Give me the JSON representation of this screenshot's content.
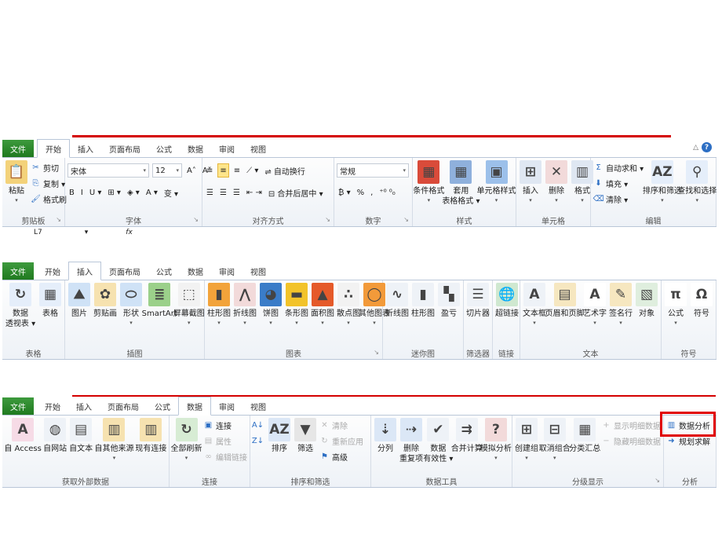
{
  "colors": {
    "file_tab": "#2a8a2a",
    "accent_red": "#d40000",
    "highlight": "#fde58a"
  },
  "ribbons": [
    {
      "tabs": [
        "文件",
        "开始",
        "插入",
        "页面布局",
        "公式",
        "数据",
        "审阅",
        "视图"
      ],
      "active_tab": 1,
      "help_icons": [
        "minimize-ribbon-icon",
        "help-icon"
      ],
      "namebox": "L7",
      "fx": "fx",
      "groups": [
        {
          "label": "剪贴板",
          "launcher": true,
          "cols": [
            {
              "t": "large",
              "label": "粘贴",
              "icon": "paste-icon",
              "dd": true
            },
            {
              "t": "small",
              "items": [
                {
                  "label": "剪切",
                  "icon": "scissors-icon"
                },
                {
                  "label": "复制 ▾",
                  "icon": "copy-icon"
                },
                {
                  "label": "格式刷",
                  "icon": "format-painter-icon"
                }
              ]
            }
          ]
        },
        {
          "label": "字体",
          "launcher": true,
          "cols": [
            {
              "t": "rows",
              "rows": [
                [
                  {
                    "kind": "combo",
                    "name": "font-name-combo",
                    "text": "宋体"
                  },
                  {
                    "kind": "combo",
                    "name": "font-size-combo",
                    "text": "12"
                  },
                  {
                    "kind": "btn",
                    "name": "grow-font-button",
                    "text": "A˄"
                  },
                  {
                    "kind": "btn",
                    "name": "shrink-font-button",
                    "text": "A˅"
                  }
                ],
                [
                  {
                    "kind": "btn",
                    "name": "bold-button",
                    "text": "B"
                  },
                  {
                    "kind": "btn",
                    "name": "italic-button",
                    "text": "I"
                  },
                  {
                    "kind": "btn",
                    "name": "underline-button",
                    "text": "U ▾"
                  },
                  {
                    "kind": "btn",
                    "name": "border-button",
                    "text": "⊞ ▾"
                  },
                  {
                    "kind": "btn",
                    "name": "fill-color-button",
                    "text": "◈ ▾"
                  },
                  {
                    "kind": "btn",
                    "name": "font-color-button",
                    "text": "A ▾"
                  },
                  {
                    "kind": "btn",
                    "name": "phonetic-button",
                    "text": "变 ▾"
                  }
                ]
              ]
            }
          ]
        },
        {
          "label": "对齐方式",
          "launcher": true,
          "cols": [
            {
              "t": "rows",
              "rows": [
                [
                  {
                    "kind": "btn",
                    "name": "align-top-button",
                    "text": "≡"
                  },
                  {
                    "kind": "btn",
                    "name": "align-middle-button",
                    "text": "≡",
                    "hl": true
                  },
                  {
                    "kind": "btn",
                    "name": "align-bottom-button",
                    "text": "≡"
                  },
                  {
                    "kind": "btn",
                    "name": "orientation-button",
                    "text": "⟋ ▾"
                  },
                  {
                    "kind": "btn",
                    "name": "wrap-text-button",
                    "text": "⇌ 自动换行"
                  }
                ],
                [
                  {
                    "kind": "btn",
                    "name": "align-left-button",
                    "text": "☰"
                  },
                  {
                    "kind": "btn",
                    "name": "align-center-button",
                    "text": "☰"
                  },
                  {
                    "kind": "btn",
                    "name": "align-right-button",
                    "text": "☰"
                  },
                  {
                    "kind": "btn",
                    "name": "indent-button",
                    "text": "⇤ ⇥"
                  },
                  {
                    "kind": "btn",
                    "name": "merge-center-button",
                    "text": "⊟ 合并后居中 ▾"
                  }
                ]
              ]
            }
          ]
        },
        {
          "label": "数字",
          "launcher": true,
          "cols": [
            {
              "t": "rows",
              "rows": [
                [
                  {
                    "kind": "combo",
                    "name": "number-format-combo",
                    "text": "常规"
                  }
                ],
                [
                  {
                    "kind": "btn",
                    "name": "currency-button",
                    "text": "₿ ▾"
                  },
                  {
                    "kind": "btn",
                    "name": "percent-button",
                    "text": "%"
                  },
                  {
                    "kind": "btn",
                    "name": "comma-button",
                    "text": ","
                  },
                  {
                    "kind": "btn",
                    "name": "decimal-button",
                    "text": "⁺⁰ ⁰₀"
                  }
                ]
              ]
            }
          ]
        },
        {
          "label": "样式",
          "cols": [
            {
              "t": "large",
              "label": "条件格式",
              "icon": "conditional-format-icon",
              "dd": true
            },
            {
              "t": "large",
              "label": "套用\n表格格式 ▾",
              "icon": "table-format-icon"
            },
            {
              "t": "large",
              "label": "单元格样式",
              "icon": "cell-style-icon",
              "dd": true
            }
          ]
        },
        {
          "label": "单元格",
          "cols": [
            {
              "t": "large",
              "label": "插入",
              "icon": "insert-cells-icon",
              "dd": true
            },
            {
              "t": "large",
              "label": "删除",
              "icon": "delete-cells-icon",
              "dd": true
            },
            {
              "t": "large",
              "label": "格式",
              "icon": "format-cells-icon",
              "dd": true
            }
          ]
        },
        {
          "label": "编辑",
          "cols": [
            {
              "t": "small",
              "items": [
                {
                  "label": "自动求和 ▾",
                  "icon": "sigma-icon"
                },
                {
                  "label": "填充 ▾",
                  "icon": "fill-down-icon"
                },
                {
                  "label": "清除 ▾",
                  "icon": "eraser-icon"
                }
              ]
            },
            {
              "t": "large",
              "label": "排序和筛选",
              "icon": "sort-filter-icon",
              "dd": true
            },
            {
              "t": "large",
              "label": "查找和选择",
              "icon": "binoculars-icon",
              "dd": true
            }
          ]
        }
      ]
    },
    {
      "tabs": [
        "文件",
        "开始",
        "插入",
        "页面布局",
        "公式",
        "数据",
        "审阅",
        "视图"
      ],
      "active_tab": 2,
      "groups": [
        {
          "label": "表格",
          "cols": [
            {
              "t": "large",
              "label": "数据\n透视表 ▾",
              "icon": "pivot-table-icon"
            },
            {
              "t": "large",
              "label": "表格",
              "icon": "table-icon"
            }
          ]
        },
        {
          "label": "插图",
          "cols": [
            {
              "t": "large",
              "label": "图片",
              "icon": "picture-icon"
            },
            {
              "t": "large",
              "label": "剪贴画",
              "icon": "clip-art-icon"
            },
            {
              "t": "large",
              "label": "形状",
              "icon": "shapes-icon",
              "dd": true
            },
            {
              "t": "large",
              "label": "SmartArt",
              "icon": "smartart-icon"
            },
            {
              "t": "large",
              "label": "屏幕截图",
              "icon": "screenshot-icon",
              "dd": true
            }
          ]
        },
        {
          "label": "图表",
          "launcher": true,
          "cols": [
            {
              "t": "large",
              "label": "柱形图",
              "icon": "column-chart-icon",
              "dd": true
            },
            {
              "t": "large",
              "label": "折线图",
              "icon": "line-chart-icon",
              "dd": true
            },
            {
              "t": "large",
              "label": "饼图",
              "icon": "pie-chart-icon",
              "dd": true
            },
            {
              "t": "large",
              "label": "条形图",
              "icon": "bar-chart-icon",
              "dd": true
            },
            {
              "t": "large",
              "label": "面积图",
              "icon": "area-chart-icon",
              "dd": true
            },
            {
              "t": "large",
              "label": "散点图",
              "icon": "scatter-chart-icon",
              "dd": true
            },
            {
              "t": "large",
              "label": "其他图表",
              "icon": "other-charts-icon",
              "dd": true
            }
          ]
        },
        {
          "label": "迷你图",
          "cols": [
            {
              "t": "large",
              "label": "折线图",
              "icon": "sparkline-line-icon"
            },
            {
              "t": "large",
              "label": "柱形图",
              "icon": "sparkline-column-icon"
            },
            {
              "t": "large",
              "label": "盈亏",
              "icon": "sparkline-winloss-icon"
            }
          ]
        },
        {
          "label": "筛选器",
          "cols": [
            {
              "t": "large",
              "label": "切片器",
              "icon": "slicer-icon"
            }
          ]
        },
        {
          "label": "链接",
          "cols": [
            {
              "t": "large",
              "label": "超链接",
              "icon": "hyperlink-icon"
            }
          ]
        },
        {
          "label": "文本",
          "cols": [
            {
              "t": "large",
              "label": "文本框",
              "icon": "textbox-icon",
              "dd": true
            },
            {
              "t": "large",
              "label": "页眉和页脚",
              "icon": "header-footer-icon"
            },
            {
              "t": "large",
              "label": "艺术字",
              "icon": "wordart-icon",
              "dd": true
            },
            {
              "t": "large",
              "label": "签名行",
              "icon": "signature-icon",
              "dd": true
            },
            {
              "t": "large",
              "label": "对象",
              "icon": "object-icon"
            }
          ]
        },
        {
          "label": "符号",
          "cols": [
            {
              "t": "large",
              "label": "公式",
              "icon": "pi-icon",
              "dd": true
            },
            {
              "t": "large",
              "label": "符号",
              "icon": "omega-icon"
            }
          ]
        }
      ]
    },
    {
      "tabs": [
        "文件",
        "开始",
        "插入",
        "页面布局",
        "公式",
        "数据",
        "审阅",
        "视图"
      ],
      "active_tab": 5,
      "groups": [
        {
          "label": "获取外部数据",
          "cols": [
            {
              "t": "large",
              "label": "自 Access",
              "icon": "access-icon"
            },
            {
              "t": "large",
              "label": "自网站",
              "icon": "web-icon"
            },
            {
              "t": "large",
              "label": "自文本",
              "icon": "text-file-icon"
            },
            {
              "t": "large",
              "label": "自其他来源",
              "icon": "other-sources-icon",
              "dd": true
            },
            {
              "t": "large",
              "label": "现有连接",
              "icon": "existing-connections-icon"
            }
          ]
        },
        {
          "label": "连接",
          "cols": [
            {
              "t": "large",
              "label": "全部刷新",
              "icon": "refresh-all-icon",
              "dd": true
            },
            {
              "t": "small",
              "items": [
                {
                  "label": "连接",
                  "icon": "connections-icon"
                },
                {
                  "label": "属性",
                  "icon": "properties-icon",
                  "disabled": true
                },
                {
                  "label": "编辑链接",
                  "icon": "edit-links-icon",
                  "disabled": true
                }
              ]
            }
          ]
        },
        {
          "label": "排序和筛选",
          "cols": [
            {
              "t": "small",
              "items": [
                {
                  "label": "",
                  "icon": "sort-asc-icon"
                },
                {
                  "label": "",
                  "icon": "sort-desc-icon"
                }
              ]
            },
            {
              "t": "large",
              "label": "排序",
              "icon": "sort-icon"
            },
            {
              "t": "large",
              "label": "筛选",
              "icon": "filter-icon"
            },
            {
              "t": "small",
              "items": [
                {
                  "label": "清除",
                  "icon": "clear-filter-icon",
                  "disabled": true
                },
                {
                  "label": "重新应用",
                  "icon": "reapply-icon",
                  "disabled": true
                },
                {
                  "label": "高级",
                  "icon": "advanced-filter-icon"
                }
              ]
            }
          ]
        },
        {
          "label": "数据工具",
          "cols": [
            {
              "t": "large",
              "label": "分列",
              "icon": "text-to-columns-icon"
            },
            {
              "t": "large",
              "label": "删除\n重复项",
              "icon": "remove-duplicates-icon"
            },
            {
              "t": "large",
              "label": "数据\n有效性 ▾",
              "icon": "data-validation-icon"
            },
            {
              "t": "large",
              "label": "合并计算",
              "icon": "consolidate-icon"
            },
            {
              "t": "large",
              "label": "模拟分析",
              "icon": "what-if-icon",
              "dd": true
            }
          ]
        },
        {
          "label": "分级显示",
          "launcher": true,
          "cols": [
            {
              "t": "large",
              "label": "创建组",
              "icon": "group-icon",
              "dd": true
            },
            {
              "t": "large",
              "label": "取消组合",
              "icon": "ungroup-icon",
              "dd": true
            },
            {
              "t": "large",
              "label": "分类汇总",
              "icon": "subtotal-icon"
            },
            {
              "t": "small",
              "items": [
                {
                  "label": "显示明细数据",
                  "icon": "show-detail-icon",
                  "disabled": true
                },
                {
                  "label": "隐藏明细数据",
                  "icon": "hide-detail-icon",
                  "disabled": true
                }
              ]
            }
          ]
        },
        {
          "label": "分析",
          "cols": [
            {
              "t": "small",
              "items": [
                {
                  "label": "数据分析",
                  "icon": "data-analysis-icon"
                },
                {
                  "label": "规划求解",
                  "icon": "solver-icon"
                }
              ]
            }
          ]
        }
      ]
    }
  ]
}
